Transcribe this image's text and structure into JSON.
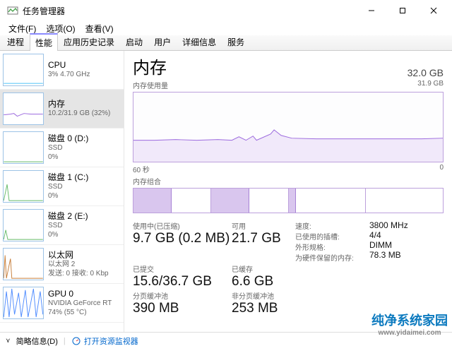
{
  "window": {
    "title": "任务管理器"
  },
  "menu": {
    "file": "文件(F)",
    "options": "选项(O)",
    "view": "查看(V)"
  },
  "tabs": {
    "processes": "进程",
    "performance": "性能",
    "apphistory": "应用历史记录",
    "startup": "启动",
    "users": "用户",
    "details": "详细信息",
    "services": "服务"
  },
  "sidebar": [
    {
      "name": "CPU",
      "detail": "3%  4.70 GHz"
    },
    {
      "name": "内存",
      "detail": "10.2/31.9 GB (32%)"
    },
    {
      "name": "磁盘 0 (D:)",
      "detail": "SSD",
      "detail2": "0%"
    },
    {
      "name": "磁盘 1 (C:)",
      "detail": "SSD",
      "detail2": "0%"
    },
    {
      "name": "磁盘 2 (E:)",
      "detail": "SSD",
      "detail2": "0%"
    },
    {
      "name": "以太网",
      "detail": "以太网 2",
      "detail2": "发送: 0  接收: 0 Kbp"
    },
    {
      "name": "GPU 0",
      "detail": "NVIDIA GeForce RT",
      "detail2": "74%  (55 °C)"
    }
  ],
  "main": {
    "title": "内存",
    "total": "32.0 GB",
    "usage_label": "内存使用量",
    "usage_max": "31.9 GB",
    "time_left": "60 秒",
    "time_right": "0",
    "compo_label": "内存组合",
    "fields": {
      "inuse_lbl": "使用中(已压缩)",
      "inuse_val": "9.7 GB (0.2 MB)",
      "avail_lbl": "可用",
      "avail_val": "21.7 GB",
      "speed_lbl": "速度:",
      "speed_val": "3800 MHz",
      "slots_lbl": "已使用的插槽:",
      "slots_val": "4/4",
      "commit_lbl": "已提交",
      "commit_val": "15.6/36.7 GB",
      "cached_lbl": "已缓存",
      "cached_val": "6.6 GB",
      "form_lbl": "外形规格:",
      "form_val": "DIMM",
      "reserved_lbl": "为硬件保留的内存:",
      "reserved_val": "78.3 MB",
      "paged_lbl": "分页缓冲池",
      "paged_val": "390 MB",
      "nonpaged_lbl": "非分页缓冲池",
      "nonpaged_val": "253 MB"
    }
  },
  "status": {
    "brief": "简略信息(D)",
    "open_monitor": "打开资源监视器"
  },
  "watermark": {
    "brand": "纯净系统家园",
    "url": "www.yidaimei.com"
  },
  "chart_data": {
    "type": "area",
    "title": "内存使用量",
    "xlabel": "秒",
    "ylabel": "GB",
    "xlim": [
      60,
      0
    ],
    "ylim": [
      0,
      31.9
    ],
    "series": [
      {
        "name": "内存",
        "values": [
          10.0,
          10.0,
          10.1,
          10.0,
          10.1,
          10.0,
          10.0,
          10.0,
          10.1,
          10.0,
          10.1,
          10.0,
          10.1,
          10.1,
          10.0,
          10.1,
          10.0,
          10.2,
          10.9,
          11.6,
          10.8,
          10.5,
          10.4,
          10.4,
          10.2,
          10.3,
          10.3,
          10.3,
          10.4,
          10.3,
          10.2,
          10.3,
          10.3,
          10.3,
          10.3,
          10.3,
          10.3,
          10.3,
          10.3,
          10.3,
          10.3,
          10.3,
          10.4,
          10.4,
          10.3,
          10.2,
          10.3,
          10.2,
          10.2,
          10.2,
          10.2,
          10.2,
          10.2,
          10.2,
          10.2,
          10.2,
          10.2,
          10.2,
          10.2,
          10.2
        ]
      }
    ]
  }
}
